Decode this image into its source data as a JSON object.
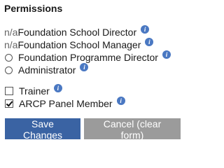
{
  "section": {
    "title": "Permissions"
  },
  "roles": [
    {
      "prefix": "n/a",
      "label": "Foundation School Director",
      "info_icon": "info-icon"
    },
    {
      "prefix": "n/a",
      "label": "Foundation School Manager",
      "info_icon": "info-icon"
    },
    {
      "control": "radio",
      "checked": false,
      "label": "Foundation Programme Director",
      "info_icon": "info-icon"
    },
    {
      "control": "radio",
      "checked": false,
      "label": "Administrator",
      "info_icon": "info-icon"
    }
  ],
  "extras": [
    {
      "control": "checkbox",
      "checked": false,
      "label": "Trainer",
      "info_icon": "info-icon"
    },
    {
      "control": "checkbox",
      "checked": true,
      "label": "ARCP Panel Member",
      "info_icon": "info-icon"
    }
  ],
  "info_glyph": "i",
  "buttons": {
    "save_label": "Save Changes",
    "cancel_label": "Cancel (clear form)"
  },
  "colors": {
    "primary_button": "#3a63a3",
    "secondary_button": "#9b9b9b",
    "info_icon": "#4a78c2"
  }
}
